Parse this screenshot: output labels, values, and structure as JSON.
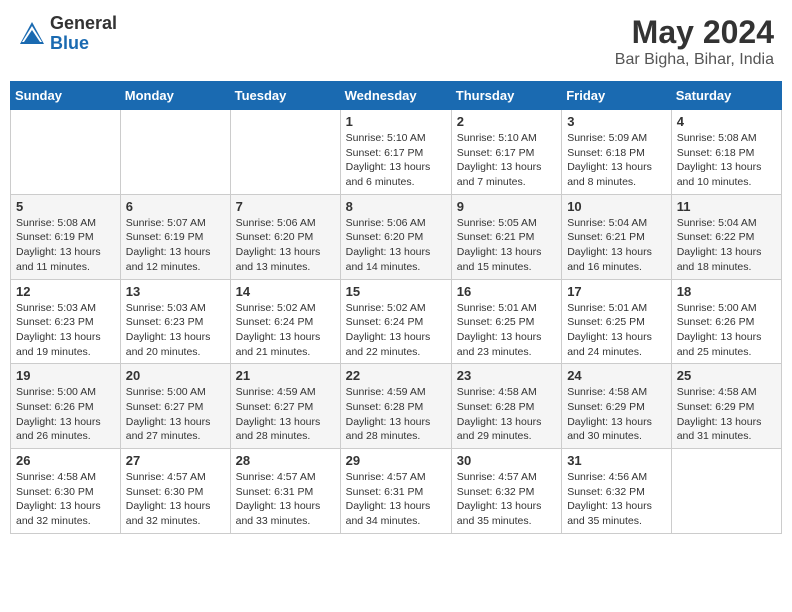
{
  "header": {
    "logo_general": "General",
    "logo_blue": "Blue",
    "month_year": "May 2024",
    "location": "Bar Bigha, Bihar, India"
  },
  "days_of_week": [
    "Sunday",
    "Monday",
    "Tuesday",
    "Wednesday",
    "Thursday",
    "Friday",
    "Saturday"
  ],
  "weeks": [
    [
      {
        "day": "",
        "info": ""
      },
      {
        "day": "",
        "info": ""
      },
      {
        "day": "",
        "info": ""
      },
      {
        "day": "1",
        "info": "Sunrise: 5:10 AM\nSunset: 6:17 PM\nDaylight: 13 hours and 6 minutes."
      },
      {
        "day": "2",
        "info": "Sunrise: 5:10 AM\nSunset: 6:17 PM\nDaylight: 13 hours and 7 minutes."
      },
      {
        "day": "3",
        "info": "Sunrise: 5:09 AM\nSunset: 6:18 PM\nDaylight: 13 hours and 8 minutes."
      },
      {
        "day": "4",
        "info": "Sunrise: 5:08 AM\nSunset: 6:18 PM\nDaylight: 13 hours and 10 minutes."
      }
    ],
    [
      {
        "day": "5",
        "info": "Sunrise: 5:08 AM\nSunset: 6:19 PM\nDaylight: 13 hours and 11 minutes."
      },
      {
        "day": "6",
        "info": "Sunrise: 5:07 AM\nSunset: 6:19 PM\nDaylight: 13 hours and 12 minutes."
      },
      {
        "day": "7",
        "info": "Sunrise: 5:06 AM\nSunset: 6:20 PM\nDaylight: 13 hours and 13 minutes."
      },
      {
        "day": "8",
        "info": "Sunrise: 5:06 AM\nSunset: 6:20 PM\nDaylight: 13 hours and 14 minutes."
      },
      {
        "day": "9",
        "info": "Sunrise: 5:05 AM\nSunset: 6:21 PM\nDaylight: 13 hours and 15 minutes."
      },
      {
        "day": "10",
        "info": "Sunrise: 5:04 AM\nSunset: 6:21 PM\nDaylight: 13 hours and 16 minutes."
      },
      {
        "day": "11",
        "info": "Sunrise: 5:04 AM\nSunset: 6:22 PM\nDaylight: 13 hours and 18 minutes."
      }
    ],
    [
      {
        "day": "12",
        "info": "Sunrise: 5:03 AM\nSunset: 6:23 PM\nDaylight: 13 hours and 19 minutes."
      },
      {
        "day": "13",
        "info": "Sunrise: 5:03 AM\nSunset: 6:23 PM\nDaylight: 13 hours and 20 minutes."
      },
      {
        "day": "14",
        "info": "Sunrise: 5:02 AM\nSunset: 6:24 PM\nDaylight: 13 hours and 21 minutes."
      },
      {
        "day": "15",
        "info": "Sunrise: 5:02 AM\nSunset: 6:24 PM\nDaylight: 13 hours and 22 minutes."
      },
      {
        "day": "16",
        "info": "Sunrise: 5:01 AM\nSunset: 6:25 PM\nDaylight: 13 hours and 23 minutes."
      },
      {
        "day": "17",
        "info": "Sunrise: 5:01 AM\nSunset: 6:25 PM\nDaylight: 13 hours and 24 minutes."
      },
      {
        "day": "18",
        "info": "Sunrise: 5:00 AM\nSunset: 6:26 PM\nDaylight: 13 hours and 25 minutes."
      }
    ],
    [
      {
        "day": "19",
        "info": "Sunrise: 5:00 AM\nSunset: 6:26 PM\nDaylight: 13 hours and 26 minutes."
      },
      {
        "day": "20",
        "info": "Sunrise: 5:00 AM\nSunset: 6:27 PM\nDaylight: 13 hours and 27 minutes."
      },
      {
        "day": "21",
        "info": "Sunrise: 4:59 AM\nSunset: 6:27 PM\nDaylight: 13 hours and 28 minutes."
      },
      {
        "day": "22",
        "info": "Sunrise: 4:59 AM\nSunset: 6:28 PM\nDaylight: 13 hours and 28 minutes."
      },
      {
        "day": "23",
        "info": "Sunrise: 4:58 AM\nSunset: 6:28 PM\nDaylight: 13 hours and 29 minutes."
      },
      {
        "day": "24",
        "info": "Sunrise: 4:58 AM\nSunset: 6:29 PM\nDaylight: 13 hours and 30 minutes."
      },
      {
        "day": "25",
        "info": "Sunrise: 4:58 AM\nSunset: 6:29 PM\nDaylight: 13 hours and 31 minutes."
      }
    ],
    [
      {
        "day": "26",
        "info": "Sunrise: 4:58 AM\nSunset: 6:30 PM\nDaylight: 13 hours and 32 minutes."
      },
      {
        "day": "27",
        "info": "Sunrise: 4:57 AM\nSunset: 6:30 PM\nDaylight: 13 hours and 32 minutes."
      },
      {
        "day": "28",
        "info": "Sunrise: 4:57 AM\nSunset: 6:31 PM\nDaylight: 13 hours and 33 minutes."
      },
      {
        "day": "29",
        "info": "Sunrise: 4:57 AM\nSunset: 6:31 PM\nDaylight: 13 hours and 34 minutes."
      },
      {
        "day": "30",
        "info": "Sunrise: 4:57 AM\nSunset: 6:32 PM\nDaylight: 13 hours and 35 minutes."
      },
      {
        "day": "31",
        "info": "Sunrise: 4:56 AM\nSunset: 6:32 PM\nDaylight: 13 hours and 35 minutes."
      },
      {
        "day": "",
        "info": ""
      }
    ]
  ]
}
